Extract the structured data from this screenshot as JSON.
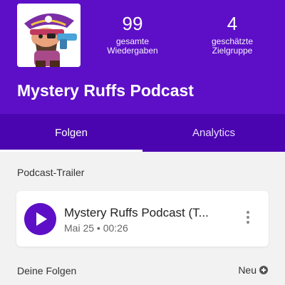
{
  "header": {
    "podcast_title": "Mystery Ruffs Podcast",
    "cover_art": "pirate-character-cover-art",
    "stats": [
      {
        "value": "99",
        "label": "gesamte Wiedergaben"
      },
      {
        "value": "4",
        "label": "geschätzte Zielgruppe"
      }
    ]
  },
  "tabs": [
    {
      "label": "Folgen",
      "active": true
    },
    {
      "label": "Analytics",
      "active": false
    }
  ],
  "trailer_section": {
    "label": "Podcast-Trailer",
    "episode": {
      "title": "Mystery Ruffs Podcast  (T...",
      "meta": "Mai 25 • 00:26"
    }
  },
  "episodes_section": {
    "label": "Deine Folgen",
    "new_label": "Neu"
  },
  "colors": {
    "header": "#5d0fc7",
    "tabs": "#4b05b0",
    "play_button": "#5d0fc7"
  }
}
